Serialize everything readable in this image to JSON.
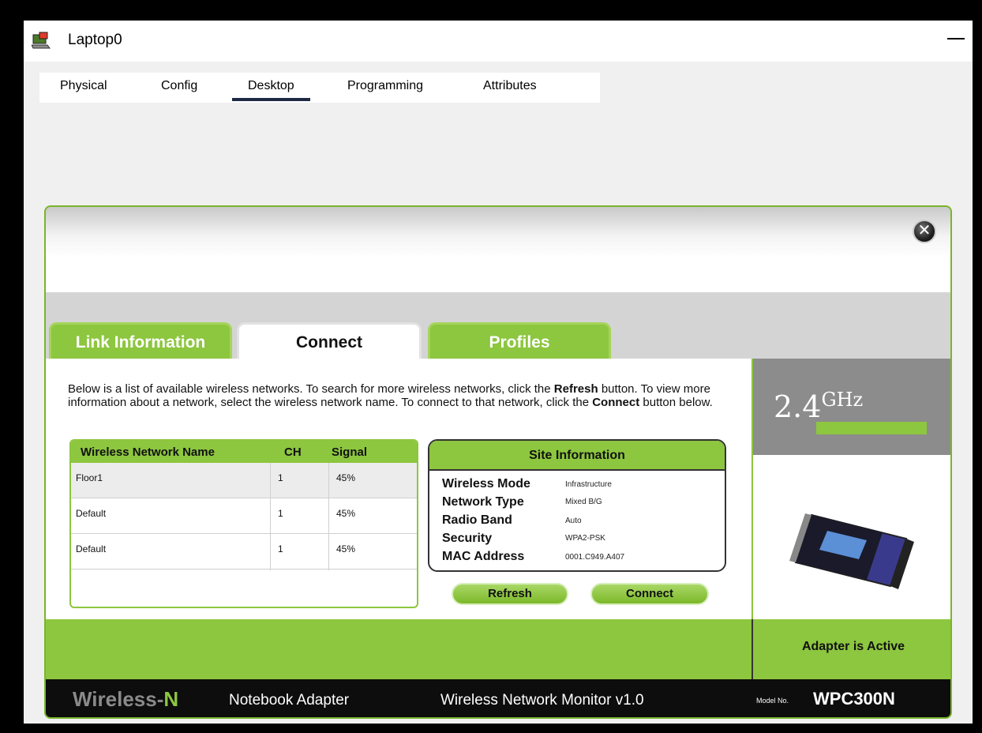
{
  "window": {
    "title": "Laptop0"
  },
  "top_tabs": [
    {
      "label": "Physical"
    },
    {
      "label": "Config"
    },
    {
      "label": "Desktop",
      "active": true
    },
    {
      "label": "Programming"
    },
    {
      "label": "Attributes"
    }
  ],
  "app_tabs": [
    {
      "label": "Link Information"
    },
    {
      "label": "Connect",
      "active": true
    },
    {
      "label": "Profiles"
    }
  ],
  "description": {
    "part1": "Below is a list of available wireless networks. To search for more wireless networks, click the ",
    "bold1": "Refresh",
    "part2": " button. To view more information about a network, select the wireless network name. To connect to that network, click the ",
    "bold2": "Connect",
    "part3": " button below."
  },
  "network_table": {
    "headers": {
      "name": "Wireless Network Name",
      "ch": "CH",
      "signal": "Signal"
    },
    "rows": [
      {
        "name": "Floor1",
        "ch": "1",
        "signal": "45%"
      },
      {
        "name": "Default",
        "ch": "1",
        "signal": "45%"
      },
      {
        "name": "Default",
        "ch": "1",
        "signal": "45%"
      }
    ]
  },
  "site_information": {
    "title": "Site Information",
    "wireless_mode_label": "Wireless Mode",
    "wireless_mode": "Infrastructure",
    "network_type_label": "Network Type",
    "network_type": "Mixed B/G",
    "radio_band_label": "Radio Band",
    "radio_band": "Auto",
    "security_label": "Security",
    "security": "WPA2-PSK",
    "mac_address_label": "MAC Address",
    "mac_address": "0001.C949.A407"
  },
  "buttons": {
    "refresh": "Refresh",
    "connect": "Connect"
  },
  "band": {
    "number": "2.4",
    "unit": "GHz"
  },
  "status": "Adapter is Active",
  "footer": {
    "brand_main": "Wireless-",
    "brand_n": "N",
    "adapter": "Notebook Adapter",
    "monitor": "Wireless Network Monitor  v1.0",
    "model_label": "Model No.",
    "model": "WPC300N"
  },
  "colors": {
    "accent_green": "#8dc63f",
    "dark": "#0d0d0d",
    "gray": "#8c8c8c"
  }
}
